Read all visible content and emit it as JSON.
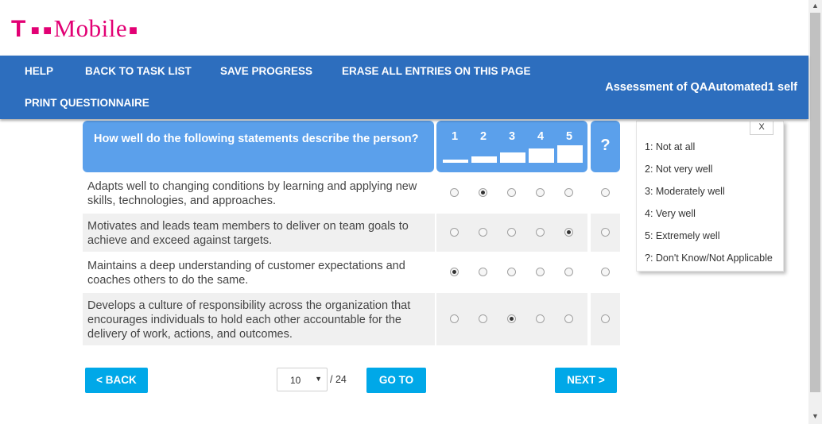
{
  "brand": {
    "logo_t": "T",
    "logo_text": "Mobile",
    "color": "#e20074"
  },
  "nav": {
    "help": "HELP",
    "back_to_task_list": "BACK TO TASK LIST",
    "save_progress": "SAVE PROGRESS",
    "erase_all": "ERASE ALL ENTRIES ON THIS PAGE",
    "print_questionnaire": "PRINT QUESTIONNAIRE",
    "assessment_title": "Assessment of QAAutomated1 self"
  },
  "question_header": "How well do the following statements describe the person?",
  "scale_labels": [
    "1",
    "2",
    "3",
    "4",
    "5"
  ],
  "unknown_label": "?",
  "rows": [
    {
      "text": "Adapts well to changing conditions by learning and applying new skills, technologies, and approaches.",
      "selected": 2
    },
    {
      "text": "Motivates and leads team members to deliver on team goals to achieve and exceed against targets.",
      "selected": 5
    },
    {
      "text": "Maintains a deep understanding of customer expectations and coaches others to do the same.",
      "selected": 1
    },
    {
      "text": "Develops a culture of responsibility across the organization that encourages individuals to hold each other accountable for the delivery of work, actions, and outcomes.",
      "selected": 3
    }
  ],
  "legend": {
    "close": "X",
    "items": [
      "1: Not at all",
      "2: Not very well",
      "3: Moderately well",
      "4: Very well",
      "5: Extremely well",
      "?: Don't Know/Not Applicable"
    ]
  },
  "footer": {
    "back": "< BACK",
    "page_value": "10",
    "page_total": "/ 24",
    "go_to": "GO TO",
    "next": "NEXT >"
  },
  "colors": {
    "nav_bg": "#2d6ebe",
    "header_bg": "#5ba0eb",
    "button_bg": "#00a8e8",
    "row_shade": "#f0f0f0"
  }
}
